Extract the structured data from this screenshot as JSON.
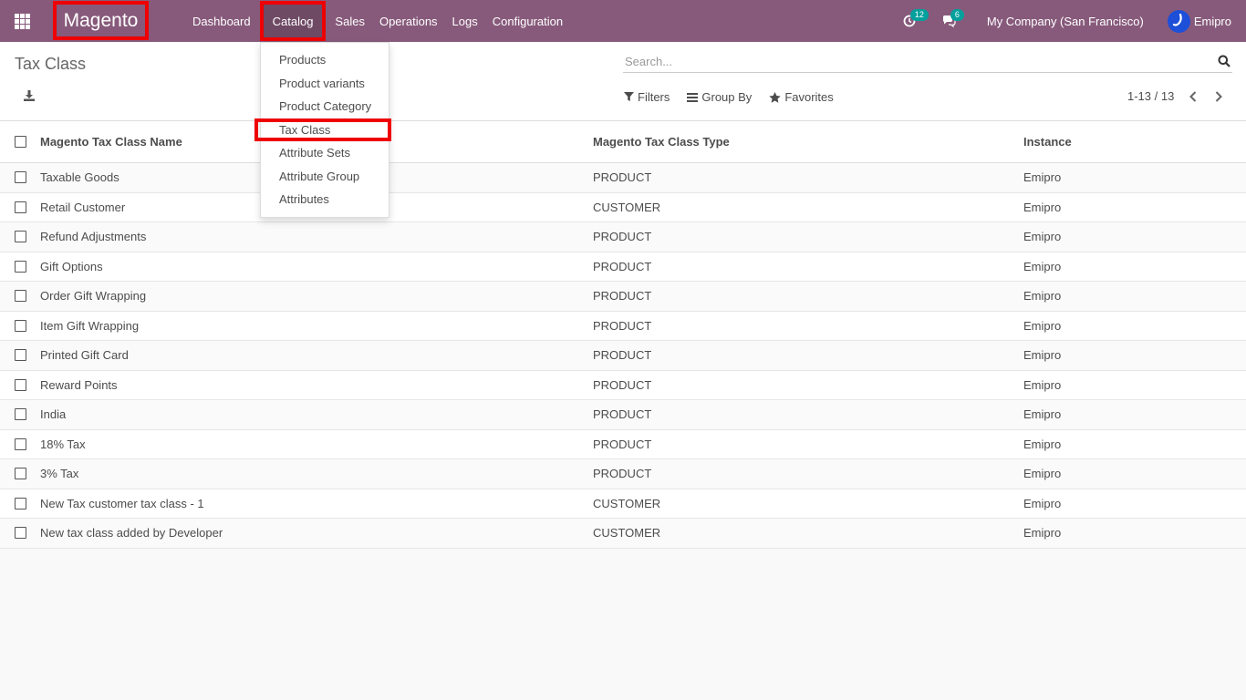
{
  "navbar": {
    "brand": "Magento",
    "menu": [
      "Dashboard",
      "Catalog",
      "Sales",
      "Operations",
      "Logs",
      "Configuration"
    ],
    "activities_count": "12",
    "messages_count": "6",
    "company": "My Company (San Francisco)",
    "user": "Emipro",
    "accent_color": "#875a7b"
  },
  "catalog_menu": {
    "items": [
      "Products",
      "Product variants",
      "Product Category",
      "Tax Class",
      "Attribute Sets",
      "Attribute Group",
      "Attributes"
    ],
    "active": "Tax Class"
  },
  "control_panel": {
    "title": "Tax Class",
    "search_placeholder": "Search...",
    "filters_label": "Filters",
    "group_by_label": "Group By",
    "favorites_label": "Favorites",
    "pager": "1-13 / 13"
  },
  "table": {
    "columns": [
      "Magento Tax Class Name",
      "Magento Tax Class Type",
      "Instance"
    ],
    "rows": [
      [
        "Taxable Goods",
        "PRODUCT",
        "Emipro"
      ],
      [
        "Retail Customer",
        "CUSTOMER",
        "Emipro"
      ],
      [
        "Refund Adjustments",
        "PRODUCT",
        "Emipro"
      ],
      [
        "Gift Options",
        "PRODUCT",
        "Emipro"
      ],
      [
        "Order Gift Wrapping",
        "PRODUCT",
        "Emipro"
      ],
      [
        "Item Gift Wrapping",
        "PRODUCT",
        "Emipro"
      ],
      [
        "Printed Gift Card",
        "PRODUCT",
        "Emipro"
      ],
      [
        "Reward Points",
        "PRODUCT",
        "Emipro"
      ],
      [
        "India",
        "PRODUCT",
        "Emipro"
      ],
      [
        "18% Tax",
        "PRODUCT",
        "Emipro"
      ],
      [
        "3% Tax",
        "PRODUCT",
        "Emipro"
      ],
      [
        "New Tax customer tax class - 1",
        "CUSTOMER",
        "Emipro"
      ],
      [
        "New tax class added by Developer",
        "CUSTOMER",
        "Emipro"
      ]
    ]
  }
}
